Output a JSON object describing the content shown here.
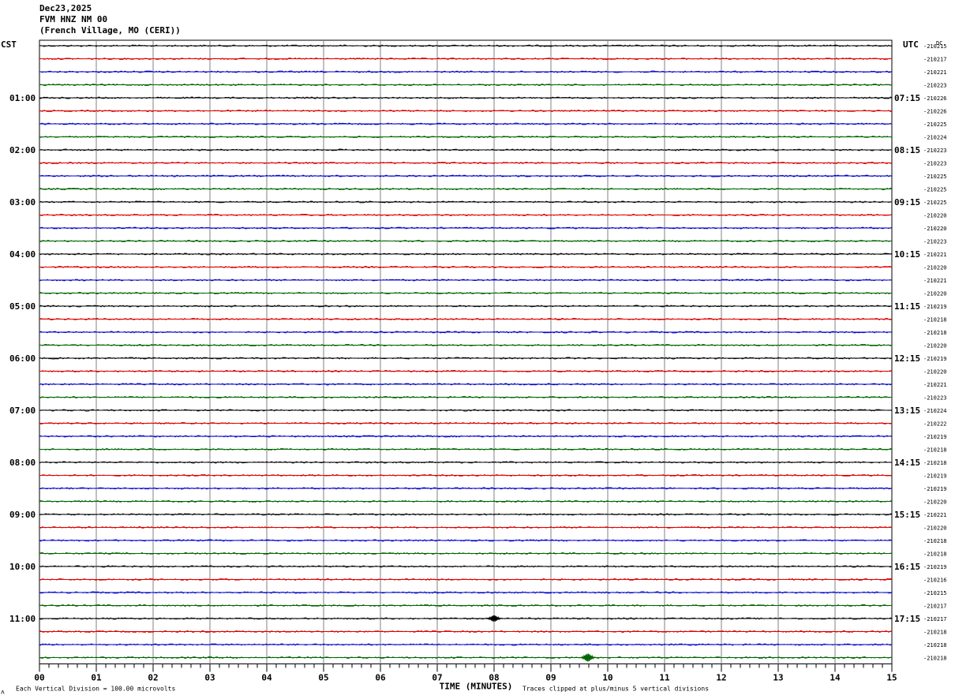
{
  "header": {
    "date": "Dec23,2025",
    "station": "FVM HNZ NM 00",
    "location": "(French Village, MO (CERI))"
  },
  "chart_data": {
    "type": "line",
    "title": "FVM HNZ NM 00",
    "left_axis_label": "CST",
    "right_axis_label": "UTC",
    "dc_label": "DC",
    "xlabel": "TIME (MINUTES)",
    "xlim": [
      0,
      15
    ],
    "x_ticks": [
      "00",
      "01",
      "02",
      "03",
      "04",
      "05",
      "06",
      "07",
      "08",
      "09",
      "10",
      "11",
      "12",
      "13",
      "14",
      "15"
    ],
    "footer_left": "Each Vertical Division =  100.00 microvolts",
    "footer_right": "Traces clipped at plus/minus 5 vertical divisions",
    "corner_mark": "ᴧ",
    "trace_colors": [
      "#000000",
      "#dd0000",
      "#0000cc",
      "#006600"
    ],
    "traces_per_hour": 4,
    "minutes_per_trace": 15,
    "cst_labels": [
      "",
      "01:00",
      "02:00",
      "03:00",
      "04:00",
      "05:00",
      "06:00",
      "07:00",
      "08:00",
      "09:00",
      "10:00",
      "11:00"
    ],
    "utc_labels": [
      "",
      "07:15",
      "08:15",
      "09:15",
      "10:15",
      "11:15",
      "12:15",
      "13:15",
      "14:15",
      "15:15",
      "16:15",
      "17:15"
    ],
    "dc_offsets": [
      "210215",
      "210217",
      "210221",
      "210223",
      "210226",
      "210226",
      "210225",
      "210224",
      "210223",
      "210223",
      "210225",
      "210225",
      "210225",
      "210220",
      "210220",
      "210223",
      "210221",
      "210220",
      "210221",
      "210220",
      "210219",
      "210218",
      "210218",
      "210220",
      "210219",
      "210220",
      "210221",
      "210223",
      "210224",
      "210222",
      "210219",
      "210218",
      "210218",
      "210219",
      "210219",
      "210220",
      "210221",
      "210220",
      "210218",
      "210218",
      "210219",
      "210216",
      "210215",
      "210217",
      "210217",
      "210218",
      "210218",
      "210218"
    ],
    "events": [
      {
        "trace": 44,
        "minute": 8.0,
        "amplitude": "medium"
      },
      {
        "trace": 47,
        "minute": 9.65,
        "amplitude": "large"
      }
    ]
  }
}
